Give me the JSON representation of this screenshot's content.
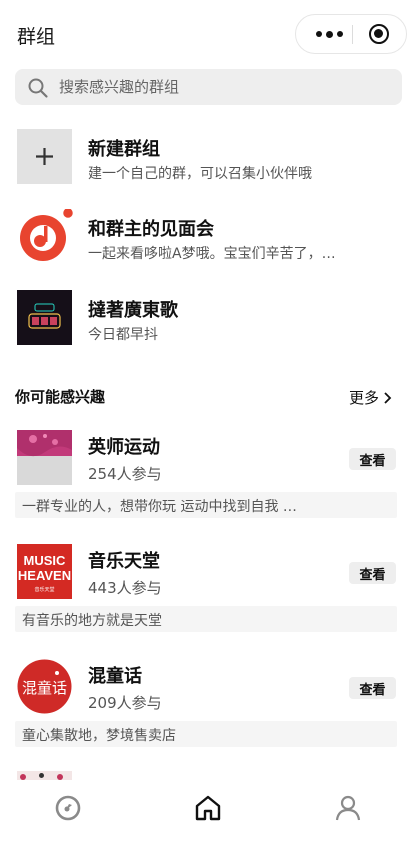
{
  "header": {
    "title": "群组"
  },
  "search": {
    "placeholder": "搜索感兴趣的群组"
  },
  "my_groups": [
    {
      "name": "新建群组",
      "desc": "建一个自己的群，可以召集小伙伴哦",
      "icon": "plus-icon"
    },
    {
      "name": "和群主的见面会",
      "desc": "一起来看哆啦A梦哦。宝宝们辛苦了，…",
      "icon": "music-note-icon"
    },
    {
      "name": "撻著廣東歌",
      "desc": "今日都早抖",
      "icon": "neon-sign-thumb"
    }
  ],
  "recommend": {
    "title": "你可能感兴趣",
    "more_label": "更多",
    "view_label": "查看",
    "groups": [
      {
        "name": "英师运动",
        "count": "254人参与",
        "intro": "一群专业的人，想带你玩 运动中找到自我 …"
      },
      {
        "name": "音乐天堂",
        "count": "443人参与",
        "intro": "有音乐的地方就是天堂",
        "logo_text": [
          "MUSIC",
          "HEAVEN",
          "音乐天堂"
        ]
      },
      {
        "name": "混童话",
        "count": "209人参与",
        "intro": "童心集散地，梦境售卖店",
        "logo_text": "混童话"
      }
    ]
  },
  "colors": {
    "accent_red": "#e8442f",
    "music_red": "#d42a23",
    "dark": "#111111",
    "grey_bg": "#eeeeee"
  }
}
